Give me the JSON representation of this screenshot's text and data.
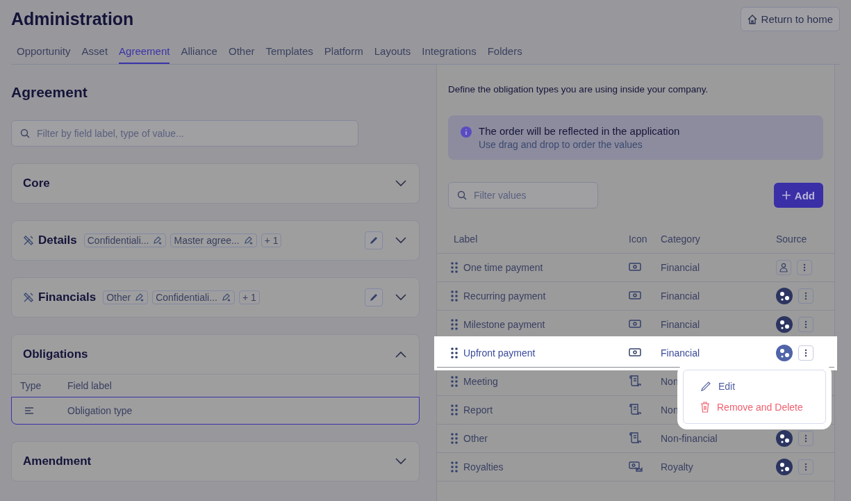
{
  "header": {
    "title": "Administration",
    "return_button": "Return to home"
  },
  "tabs": [
    {
      "label": "Opportunity",
      "selected": false
    },
    {
      "label": "Asset",
      "selected": false
    },
    {
      "label": "Agreement",
      "selected": true
    },
    {
      "label": "Alliance",
      "selected": false
    },
    {
      "label": "Other",
      "selected": false
    },
    {
      "label": "Templates",
      "selected": false
    },
    {
      "label": "Platform",
      "selected": false
    },
    {
      "label": "Layouts",
      "selected": false
    },
    {
      "label": "Integrations",
      "selected": false
    },
    {
      "label": "Folders",
      "selected": false
    }
  ],
  "left": {
    "title": "Agreement",
    "search": {
      "placeholder": "Filter by field label, type of value..."
    },
    "sections": [
      {
        "title": "Core",
        "kind": "standard",
        "expanded": false,
        "editable": false
      },
      {
        "title": "Details",
        "kind": "custom",
        "expanded": false,
        "editable": true,
        "tags": [
          "Confidentiali...",
          "Master agree..."
        ],
        "more": "+ 1"
      },
      {
        "title": "Financials",
        "kind": "custom",
        "expanded": false,
        "editable": true,
        "tags": [
          "Other",
          "Confidentiali..."
        ],
        "more": "+ 1"
      },
      {
        "title": "Obligations",
        "kind": "standard",
        "expanded": true,
        "editable": false,
        "columns": [
          "Type",
          "Field label"
        ],
        "rows": [
          {
            "label": "Obligation type",
            "selected": true
          }
        ]
      },
      {
        "title": "Amendment",
        "kind": "standard",
        "expanded": false,
        "editable": false
      }
    ]
  },
  "right": {
    "description": "Define the obligation types you are using inside your company.",
    "notice": {
      "title": "The order will be reflected in the application",
      "subtitle": "Use drag and drop to order the values"
    },
    "filter": {
      "placeholder": "Filter values"
    },
    "add_button": "Add",
    "columns": [
      "Label",
      "Icon",
      "Category",
      "Source"
    ],
    "rows": [
      {
        "label": "One time payment",
        "icon": {
          "kind": "cash"
        },
        "category": "Financial",
        "source": {
          "kind": "user"
        },
        "selected": false
      },
      {
        "label": "Recurring payment",
        "icon": {
          "kind": "cash"
        },
        "category": "Financial",
        "source": {
          "kind": "system"
        },
        "selected": false
      },
      {
        "label": "Milestone payment",
        "icon": {
          "kind": "cash"
        },
        "category": "Financial",
        "source": {
          "kind": "system"
        },
        "selected": false
      },
      {
        "label": "Upfront payment",
        "icon": {
          "kind": "cash"
        },
        "category": "Financial",
        "source": {
          "kind": "system"
        },
        "selected": true
      },
      {
        "label": "Meeting",
        "icon": {
          "kind": "scroll"
        },
        "category": "Non",
        "selected": false
      },
      {
        "label": "Report",
        "icon": {
          "kind": "scroll"
        },
        "category": "Non",
        "selected": false
      },
      {
        "label": "Other",
        "icon": {
          "kind": "scroll"
        },
        "category": "Non-financial",
        "source": {
          "kind": "system"
        },
        "selected": false
      },
      {
        "label": "Royalties",
        "icon": {
          "kind": "royalty"
        },
        "category": "Royalty",
        "source": {
          "kind": "system"
        },
        "selected": false
      }
    ],
    "menu": [
      {
        "label": "Edit",
        "kind": "edit"
      },
      {
        "label": "Remove and Delete",
        "kind": "danger"
      }
    ]
  }
}
